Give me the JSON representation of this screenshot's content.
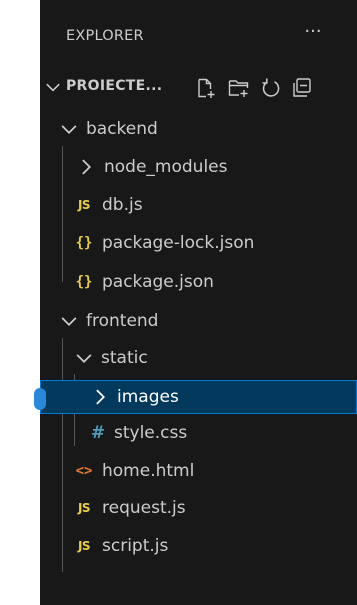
{
  "explorer": {
    "title": "EXPLORER",
    "more_label": "···"
  },
  "section": {
    "title": "PROIECTE...",
    "actions": [
      "new-file-icon",
      "new-folder-icon",
      "refresh-icon",
      "collapse-all-icon"
    ]
  },
  "tree": [
    {
      "label": "backend",
      "type": "folder",
      "expanded": true,
      "depth": 1
    },
    {
      "label": "node_modules",
      "type": "folder",
      "expanded": false,
      "depth": 2
    },
    {
      "label": "db.js",
      "type": "js",
      "icon_text": "JS",
      "depth": 2
    },
    {
      "label": "package-lock.json",
      "type": "json",
      "icon_text": "{}",
      "depth": 2
    },
    {
      "label": "package.json",
      "type": "json",
      "icon_text": "{}",
      "depth": 2
    },
    {
      "label": "frontend",
      "type": "folder",
      "expanded": true,
      "depth": 1
    },
    {
      "label": "static",
      "type": "folder",
      "expanded": true,
      "depth": 2
    },
    {
      "label": "images",
      "type": "folder",
      "expanded": false,
      "depth": 3,
      "selected": true
    },
    {
      "label": "style.css",
      "type": "css",
      "icon_text": "#",
      "depth": 3
    },
    {
      "label": "home.html",
      "type": "html",
      "icon_text": "<>",
      "depth": 2
    },
    {
      "label": "request.js",
      "type": "js",
      "icon_text": "JS",
      "depth": 2
    },
    {
      "label": "script.js",
      "type": "js",
      "icon_text": "JS",
      "depth": 2
    }
  ],
  "colors": {
    "panel_bg": "#181818",
    "text": "#cccccc",
    "selection_bg": "#04395e",
    "selection_border": "#0078d4",
    "js": "#e6cd4d",
    "json": "#e6cd4d",
    "css": "#519aba",
    "html": "#e37933"
  }
}
